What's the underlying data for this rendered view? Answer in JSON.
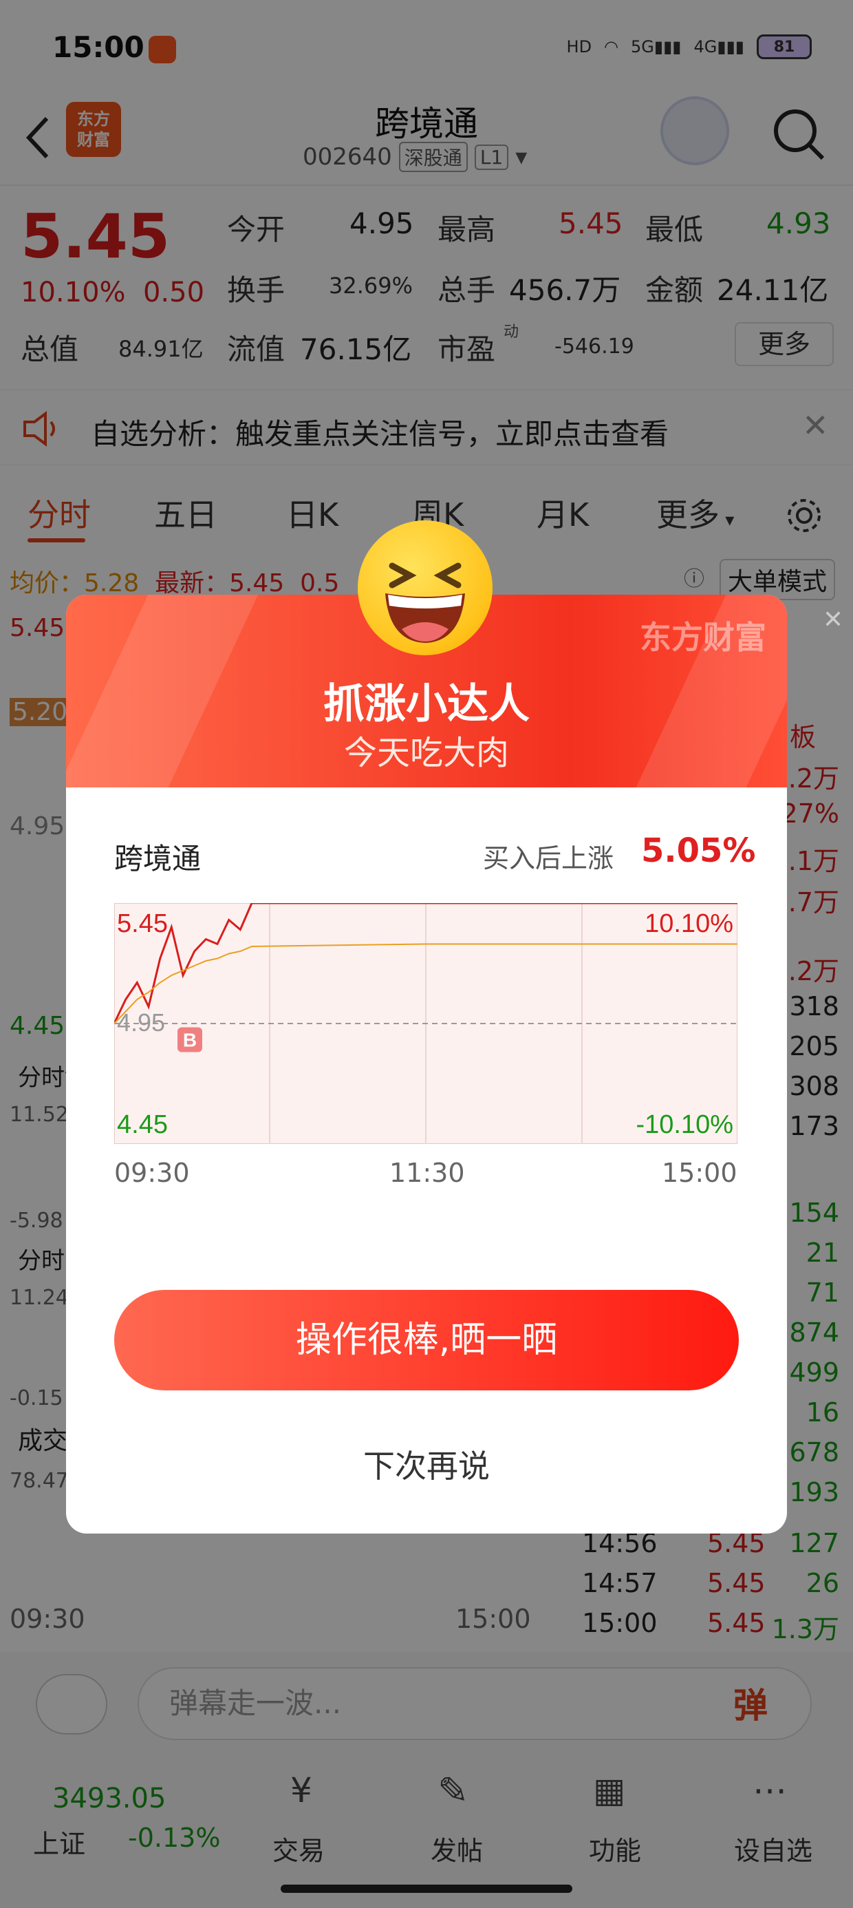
{
  "status_bar": {
    "time": "15:00",
    "battery": "81"
  },
  "header": {
    "title": "跨境通",
    "code": "002640",
    "tag1": "深股通",
    "tag2": "L1",
    "logo_line1": "东方",
    "logo_line2": "财富"
  },
  "quote": {
    "price": "5.45",
    "change_pct": "10.10%",
    "change_amt": "0.50",
    "open_label": "今开",
    "open": "4.95",
    "high_label": "最高",
    "high": "5.45",
    "low_label": "最低",
    "low": "4.93",
    "turnover_label": "换手",
    "turnover": "32.69%",
    "volume_label": "总手",
    "volume": "456.7万",
    "amount_label": "金额",
    "amount": "24.11亿",
    "mktcap_label": "总值",
    "mktcap": "84.91亿",
    "float_label": "流值",
    "float": "76.15亿",
    "pe_label": "市盈",
    "pe_sup": "动",
    "pe": "-546.19",
    "more": "更多"
  },
  "banner": {
    "text": "自选分析：触发重点关注信号，立即点击查看"
  },
  "tabs": [
    "分时",
    "五日",
    "日K",
    "周K",
    "月K",
    "更多"
  ],
  "chart_meta": {
    "avg_label": "均价：",
    "avg": "5.28",
    "latest_label": "最新：",
    "latest": "5.45",
    "latest_chg": "0.5",
    "mode": "大单模式",
    "left_labels": [
      "5.45",
      "5.20",
      "4.95",
      "4.45",
      "分时博",
      "11.52",
      "-5.98",
      "分时D",
      "11.24",
      "-0.15",
      "成交",
      "78.47"
    ],
    "bottom_time_start": "09:30",
    "bottom_time_end": "15:00"
  },
  "right_panel": {
    "head": "板",
    "rows": [
      "3.2万",
      "27%",
      "6.1万",
      "7.7万",
      "3.2万",
      "1318",
      "1205",
      "308",
      "173",
      "154",
      "21",
      "71",
      "874",
      "499",
      "16",
      "678",
      "193"
    ],
    "trades": [
      {
        "time": "14:56",
        "price": "5.45",
        "vol": "127"
      },
      {
        "time": "14:57",
        "price": "5.45",
        "vol": "26"
      },
      {
        "time": "15:00",
        "price": "5.45",
        "vol": "1.3万"
      }
    ]
  },
  "comment": {
    "placeholder": "弹幕走一波...",
    "btn": "弹"
  },
  "bottom_nav": {
    "index_value": "3493.05",
    "index_name": "上证",
    "index_chg": "-0.13%",
    "items": [
      "交易",
      "发帖",
      "功能",
      "设自选"
    ]
  },
  "modal": {
    "title": "抓涨小达人",
    "subtitle": "今天吃大肉",
    "brand": "东方财富",
    "stock": "跨境通",
    "gain_label": "买入后上涨",
    "gain_value": "5.05%",
    "chart": {
      "top_price": "5.45",
      "mid_price": "4.95",
      "bottom_price": "4.45",
      "top_pct": "10.10%",
      "bottom_pct": "-10.10%",
      "buy_mark": "B",
      "times": [
        "09:30",
        "11:30",
        "15:00"
      ]
    },
    "share_btn": "操作很棒,晒一晒",
    "later_btn": "下次再说"
  },
  "chart_data": {
    "type": "line",
    "title": "",
    "x": [
      "09:30",
      "09:35",
      "09:40",
      "09:45",
      "09:50",
      "09:55",
      "10:00",
      "10:05",
      "10:10",
      "10:15",
      "10:20",
      "10:25",
      "10:30",
      "11:30",
      "15:00"
    ],
    "series": [
      {
        "values": [
          4.95,
          5.05,
          5.12,
          5.02,
          5.22,
          5.35,
          5.15,
          5.25,
          5.3,
          5.28,
          5.38,
          5.34,
          5.45,
          5.45,
          5.45
        ]
      },
      {
        "values": [
          4.95,
          5.0,
          5.05,
          5.08,
          5.12,
          5.15,
          5.17,
          5.19,
          5.21,
          5.22,
          5.24,
          5.25,
          5.27,
          5.28,
          5.28
        ]
      }
    ],
    "ylim": [
      4.45,
      5.45
    ],
    "baseline": 4.95,
    "xlabel": "",
    "ylabel": ""
  }
}
